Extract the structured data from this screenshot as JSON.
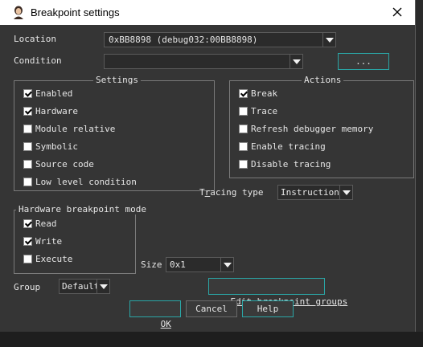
{
  "title": "Breakpoint settings",
  "location": {
    "label": "Location",
    "value": "0xBB8898 (debug032:00BB8898)"
  },
  "condition": {
    "label": "Condition",
    "value": "",
    "browse_label": "..."
  },
  "settings": {
    "title": "Settings",
    "items": [
      {
        "label": "Enabled",
        "checked": true
      },
      {
        "label": "Hardware",
        "checked": true
      },
      {
        "label": "Module relative",
        "checked": false
      },
      {
        "label": "Symbolic",
        "checked": false
      },
      {
        "label": "Source code",
        "checked": false
      },
      {
        "label": "Low level condition",
        "checked": false
      }
    ]
  },
  "actions": {
    "title": "Actions",
    "items": [
      {
        "label": "Break",
        "checked": true
      },
      {
        "label": "Trace",
        "checked": false
      },
      {
        "label": "Refresh debugger memory",
        "checked": false
      },
      {
        "label": "Enable tracing",
        "checked": false
      },
      {
        "label": "Disable tracing",
        "checked": false
      }
    ]
  },
  "tracing": {
    "label": "Tracing type",
    "value": "Instructions"
  },
  "hw_mode": {
    "title": "Hardware breakpoint mode",
    "items": [
      {
        "label": "Read",
        "checked": true
      },
      {
        "label": "Write",
        "checked": true
      },
      {
        "label": "Execute",
        "checked": false
      }
    ]
  },
  "size": {
    "label": "Size",
    "value": "0x1"
  },
  "group": {
    "label": "Group",
    "value": "Default"
  },
  "edit_groups_label": "Edit breakpoint groups",
  "buttons": {
    "ok": "OK",
    "cancel": "Cancel",
    "help": "Help"
  }
}
